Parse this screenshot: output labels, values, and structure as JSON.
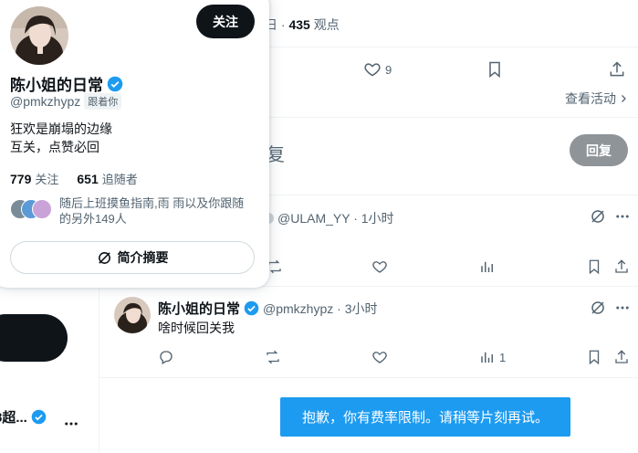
{
  "top_post": {
    "meta_suffix": "日 · ",
    "views_count": "435",
    "views_label": " 观点",
    "like_count": "9",
    "view_activity": "查看活动"
  },
  "reply_box": {
    "placeholder_text": "复",
    "reply_button": "回复"
  },
  "tweet1": {
    "handle_time": "@ULAM_YY · 1小时"
  },
  "tweet2": {
    "author_name": "陈小姐的日常",
    "handle_time": "@pmkzhypz · 3小时",
    "text": "啥时候回关我",
    "views": "1"
  },
  "rate_limit_message": "抱歉，你有费率限制。请稍等片刻再试。",
  "left_column": {
    "truncated_name": "8超..."
  },
  "hover_card": {
    "follow_button": "关注",
    "name": "陈小姐的日常",
    "handle": "@pmkzhypz",
    "follows_you_badge": "跟着你",
    "bio_line1": "狂欢是崩塌的边缘",
    "bio_line2": "互关，点赞必回",
    "following_count": "779",
    "following_label": "关注",
    "followers_count": "651",
    "followers_label": "追随者",
    "followed_by_text": "随后上班摸鱼指南,雨 雨以及你跟随的另外149人",
    "summary_button": "简介摘要"
  },
  "colors": {
    "accent_blue": "#1d9bf0",
    "text_primary": "#0f1419",
    "text_secondary": "#536471",
    "reply_disabled": "#8f9499"
  }
}
